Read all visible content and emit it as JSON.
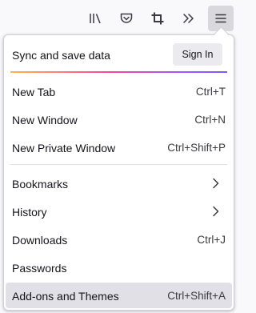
{
  "toolbar": {
    "icons": [
      "library-icon",
      "pocket-icon",
      "screenshot-icon",
      "overflow-chevron-icon",
      "hamburger-menu-icon"
    ]
  },
  "menu": {
    "sync_label": "Sync and save data",
    "signin_label": "Sign In",
    "items": [
      {
        "label": "New Tab",
        "shortcut": "Ctrl+T"
      },
      {
        "label": "New Window",
        "shortcut": "Ctrl+N"
      },
      {
        "label": "New Private Window",
        "shortcut": "Ctrl+Shift+P"
      },
      {
        "label": "Bookmarks",
        "submenu": true
      },
      {
        "label": "History",
        "submenu": true
      },
      {
        "label": "Downloads",
        "shortcut": "Ctrl+J"
      },
      {
        "label": "Passwords"
      },
      {
        "label": "Add-ons and Themes",
        "shortcut": "Ctrl+Shift+A",
        "highlighted": true
      }
    ]
  },
  "colors": {
    "accent_gradient": [
      "#ffb54d",
      "#f5479f",
      "#a455ff",
      "#7b5cf0"
    ],
    "hover_background": "#e0e0e6"
  }
}
